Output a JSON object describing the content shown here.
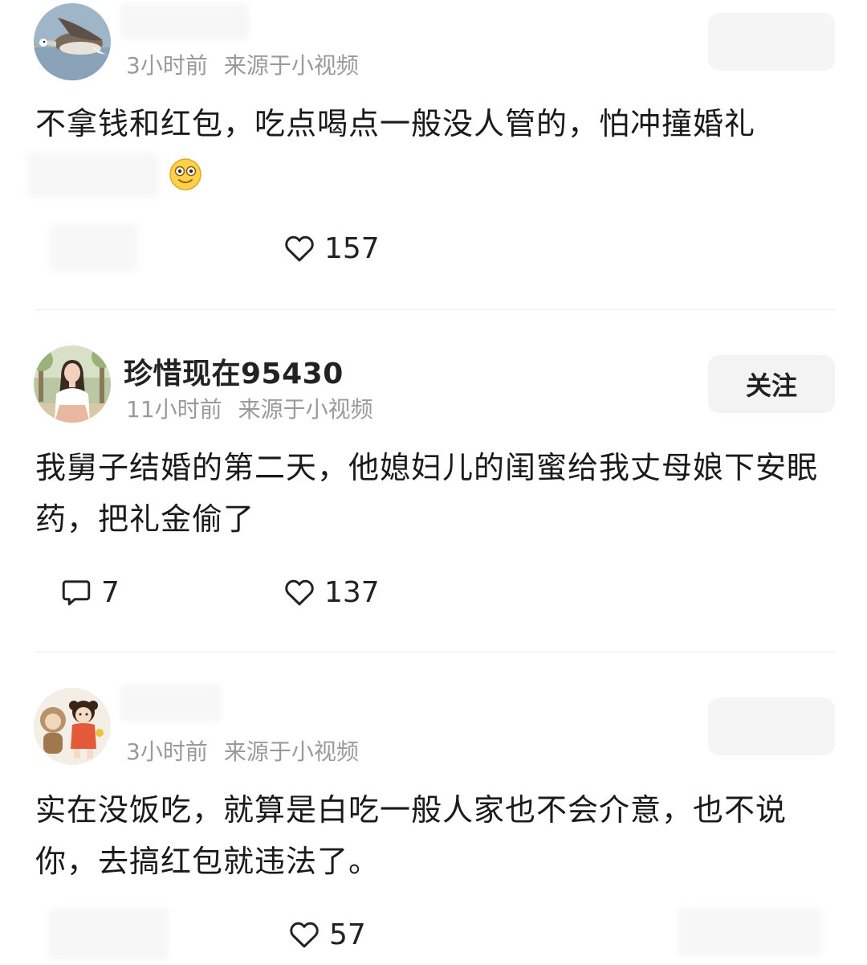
{
  "comments": [
    {
      "username": "",
      "time": "3小时前",
      "source": "来源于小视频",
      "text": "不拿钱和红包，吃点喝点一般没人管的，怕冲撞婚礼",
      "likes": "157",
      "avatar_icon": "goose-avatar"
    },
    {
      "username": "珍惜现在95430",
      "time": "11小时前",
      "source": "来源于小视频",
      "follow_label": "关注",
      "text": "我舅子结婚的第二天，他媳妇儿的闺蜜给我丈母娘下安眠药，把礼金偷了",
      "replies": "7",
      "likes": "137",
      "avatar_icon": "woman-photo-avatar"
    },
    {
      "username": "",
      "time": "3小时前",
      "source": "来源于小视频",
      "text": "实在没饭吃，就算是白吃一般人家也不会介意，也不说你，去搞红包就违法了。",
      "likes": "57",
      "avatar_icon": "cartoon-kids-avatar"
    }
  ],
  "colors": {
    "text": "#1a1a1a",
    "meta": "#9a9a9a",
    "button_bg": "#f3f3f3",
    "divider": "#ededed"
  }
}
